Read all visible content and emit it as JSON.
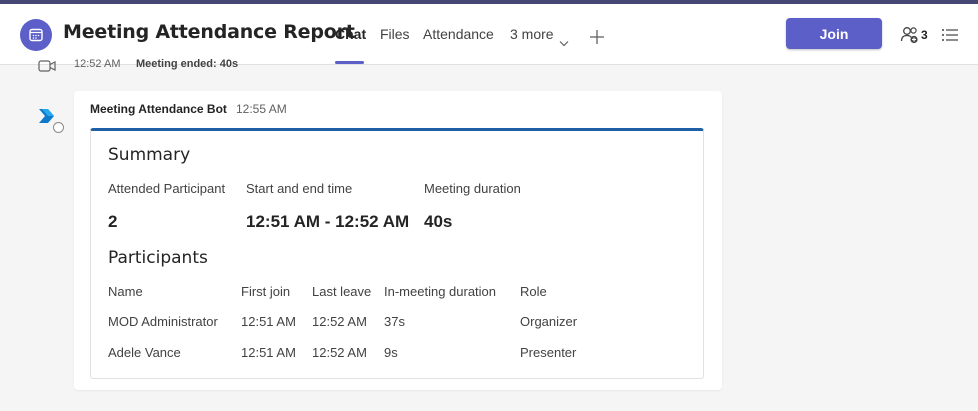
{
  "header": {
    "title": "Meeting Attendance Report",
    "tabs": [
      {
        "label": "Chat",
        "active": true
      },
      {
        "label": "Files",
        "active": false
      },
      {
        "label": "Attendance",
        "active": false
      },
      {
        "label": "3 more",
        "active": false
      }
    ],
    "join_label": "Join",
    "participant_count": "3",
    "accent_color": "#5b5fc7"
  },
  "previous_message": {
    "time": "12:52 AM",
    "text": "Meeting ended: 40s"
  },
  "message": {
    "sender": "Meeting Attendance Bot",
    "time": "12:55 AM",
    "card": {
      "summary_title": "Summary",
      "summary": {
        "attended_label": "Attended Participant",
        "attended_value": "2",
        "time_label": "Start and end time",
        "time_value": "12:51 AM - 12:52 AM",
        "duration_label": "Meeting duration",
        "duration_value": "40s"
      },
      "participants_title": "Participants",
      "columns": [
        "Name",
        "First join",
        "Last leave",
        "In-meeting duration",
        "Role"
      ],
      "rows": [
        [
          "MOD Administrator",
          "12:51 AM",
          "12:52 AM",
          "37s",
          "Organizer"
        ],
        [
          "Adele Vance",
          "12:51 AM",
          "12:52 AM",
          "9s",
          "Presenter"
        ]
      ],
      "accent_color": "#1f5fa6"
    }
  }
}
